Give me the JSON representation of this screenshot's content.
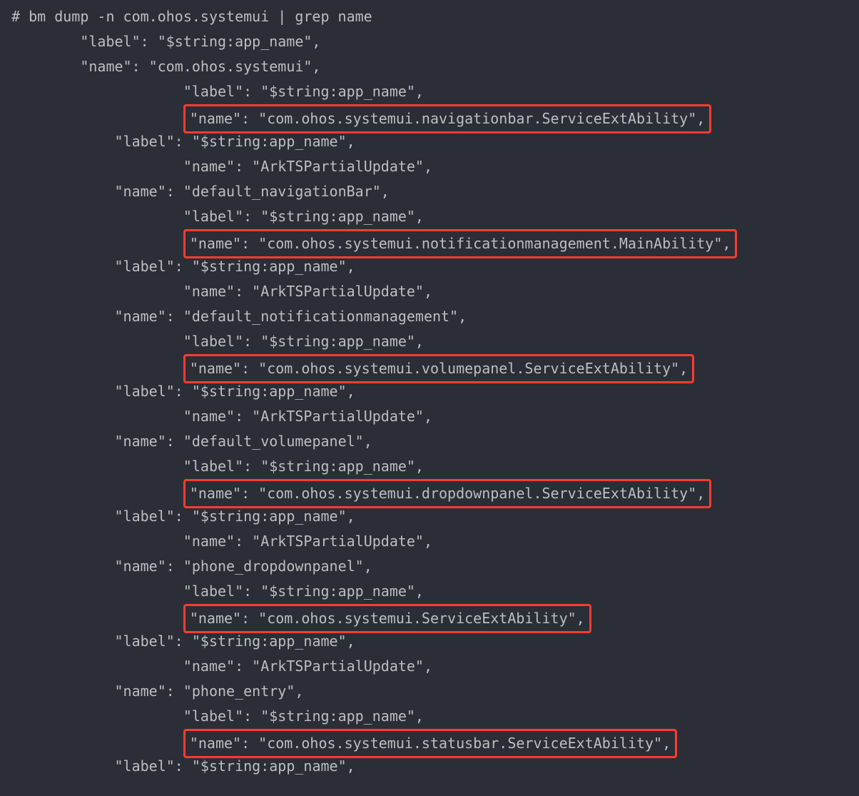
{
  "command": "# bm dump -n com.ohos.systemui | grep name",
  "lines": [
    {
      "indent": 0,
      "text": "# bm dump -n com.ohos.systemui | grep name",
      "highlight": false,
      "prompt": true
    },
    {
      "indent": 8,
      "text": "\"label\": \"$string:app_name\",",
      "highlight": false
    },
    {
      "indent": 8,
      "text": "\"name\": \"com.ohos.systemui\",",
      "highlight": false
    },
    {
      "indent": 20,
      "text": "\"label\": \"$string:app_name\",",
      "highlight": false
    },
    {
      "indent": 20,
      "text": "\"name\": \"com.ohos.systemui.navigationbar.ServiceExtAbility\",",
      "highlight": true
    },
    {
      "indent": 12,
      "text": "\"label\": \"$string:app_name\",",
      "highlight": false
    },
    {
      "indent": 20,
      "text": "\"name\": \"ArkTSPartialUpdate\",",
      "highlight": false
    },
    {
      "indent": 12,
      "text": "\"name\": \"default_navigationBar\",",
      "highlight": false
    },
    {
      "indent": 20,
      "text": "\"label\": \"$string:app_name\",",
      "highlight": false
    },
    {
      "indent": 20,
      "text": "\"name\": \"com.ohos.systemui.notificationmanagement.MainAbility\",",
      "highlight": true
    },
    {
      "indent": 12,
      "text": "\"label\": \"$string:app_name\",",
      "highlight": false
    },
    {
      "indent": 20,
      "text": "\"name\": \"ArkTSPartialUpdate\",",
      "highlight": false
    },
    {
      "indent": 12,
      "text": "\"name\": \"default_notificationmanagement\",",
      "highlight": false
    },
    {
      "indent": 20,
      "text": "\"label\": \"$string:app_name\",",
      "highlight": false
    },
    {
      "indent": 20,
      "text": "\"name\": \"com.ohos.systemui.volumepanel.ServiceExtAbility\",",
      "highlight": true
    },
    {
      "indent": 12,
      "text": "\"label\": \"$string:app_name\",",
      "highlight": false
    },
    {
      "indent": 20,
      "text": "\"name\": \"ArkTSPartialUpdate\",",
      "highlight": false
    },
    {
      "indent": 12,
      "text": "\"name\": \"default_volumepanel\",",
      "highlight": false
    },
    {
      "indent": 20,
      "text": "\"label\": \"$string:app_name\",",
      "highlight": false
    },
    {
      "indent": 20,
      "text": "\"name\": \"com.ohos.systemui.dropdownpanel.ServiceExtAbility\",",
      "highlight": true
    },
    {
      "indent": 12,
      "text": "\"label\": \"$string:app_name\",",
      "highlight": false
    },
    {
      "indent": 20,
      "text": "\"name\": \"ArkTSPartialUpdate\",",
      "highlight": false
    },
    {
      "indent": 12,
      "text": "\"name\": \"phone_dropdownpanel\",",
      "highlight": false
    },
    {
      "indent": 20,
      "text": "\"label\": \"$string:app_name\",",
      "highlight": false
    },
    {
      "indent": 20,
      "text": "\"name\": \"com.ohos.systemui.ServiceExtAbility\",",
      "highlight": true
    },
    {
      "indent": 12,
      "text": "\"label\": \"$string:app_name\",",
      "highlight": false
    },
    {
      "indent": 20,
      "text": "\"name\": \"ArkTSPartialUpdate\",",
      "highlight": false
    },
    {
      "indent": 12,
      "text": "\"name\": \"phone_entry\",",
      "highlight": false
    },
    {
      "indent": 20,
      "text": "\"label\": \"$string:app_name\",",
      "highlight": false
    },
    {
      "indent": 20,
      "text": "\"name\": \"com.ohos.systemui.statusbar.ServiceExtAbility\",",
      "highlight": true
    },
    {
      "indent": 12,
      "text": "\"label\": \"$string:app_name\",",
      "highlight": false
    }
  ]
}
